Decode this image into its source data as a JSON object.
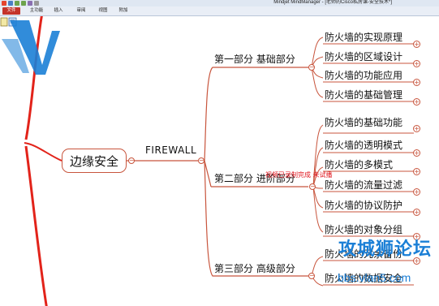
{
  "window": {
    "title": "Mindjet MindManager - [老师的Cisco私房课-安全技术*]"
  },
  "ribbon": {
    "tabs": [
      "文件",
      "主功能",
      "插入",
      "审阅",
      "视图",
      "附加"
    ]
  },
  "map": {
    "root": "边缘安全",
    "branch_label": "FIREWALL",
    "sections": [
      {
        "label": "第一部分  基础部分",
        "topics": [
          "防火墙的实现原理",
          "防火墙的区域设计",
          "防火墙的功能应用",
          "防火墙的基础管理"
        ]
      },
      {
        "label": "第二部分  进阶部分",
        "topics": [
          "防火墙的基础功能",
          "防火墙的透明模式",
          "防火墙的多模式",
          "防火墙的流量过滤",
          "防火墙的协议防护",
          "防火墙的对象分组"
        ]
      },
      {
        "label": "第三部分  高级部分",
        "topics": [
          "防火墙的冗余备份",
          "防火墙的数据安全"
        ]
      }
    ],
    "note": "视频已录制完成 未试播"
  },
  "watermark": {
    "title": "攻城狮论坛",
    "url": "bbs.vlan5.com"
  },
  "colors": {
    "branch": "#c8553d",
    "root_curve": "#e2231a",
    "note": "#e0161e",
    "watermark": "#1b7fd6",
    "file_tab": "#c4332a"
  }
}
